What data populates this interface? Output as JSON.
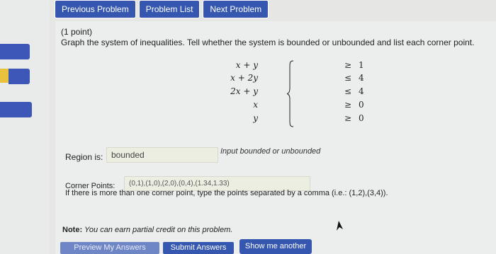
{
  "nav": {
    "previous": "Previous Problem",
    "list": "Problem List",
    "next": "Next Problem"
  },
  "problem": {
    "points": "(1 point)",
    "instruction": "Graph the system of inequalities. Tell whether the system is bounded or unbounded and list each corner point.",
    "inequalities": [
      {
        "lhs": "x + y",
        "rel": "≥",
        "rhs": "1"
      },
      {
        "lhs": "x + 2y",
        "rel": "≤",
        "rhs": "4"
      },
      {
        "lhs": "2x + y",
        "rel": "≤",
        "rhs": "4"
      },
      {
        "lhs": "x",
        "rel": "≥",
        "rhs": "0"
      },
      {
        "lhs": "y",
        "rel": "≥",
        "rhs": "0"
      }
    ]
  },
  "region": {
    "label": "Region is:",
    "value": "bounded",
    "hint": "Input bounded or unbounded"
  },
  "corner": {
    "label": "Corner Points:",
    "value": "(0,1),(1,0),(2,0),(0,4),(1.34,1.33)",
    "note": "If there is more than one corner point, type the points separated by a comma (i.e.: (1,2),(3,4))."
  },
  "note": {
    "label": "Note:",
    "text": "You can earn partial credit on this problem."
  },
  "buttons": {
    "preview": "Preview My Answers",
    "submit": "Submit Answers",
    "show": "Show me another"
  },
  "colors": {
    "button": "#3557b0",
    "background": "#e6e7e4",
    "rail": "#3c57b8",
    "accent_yellow": "#e8c23c"
  }
}
